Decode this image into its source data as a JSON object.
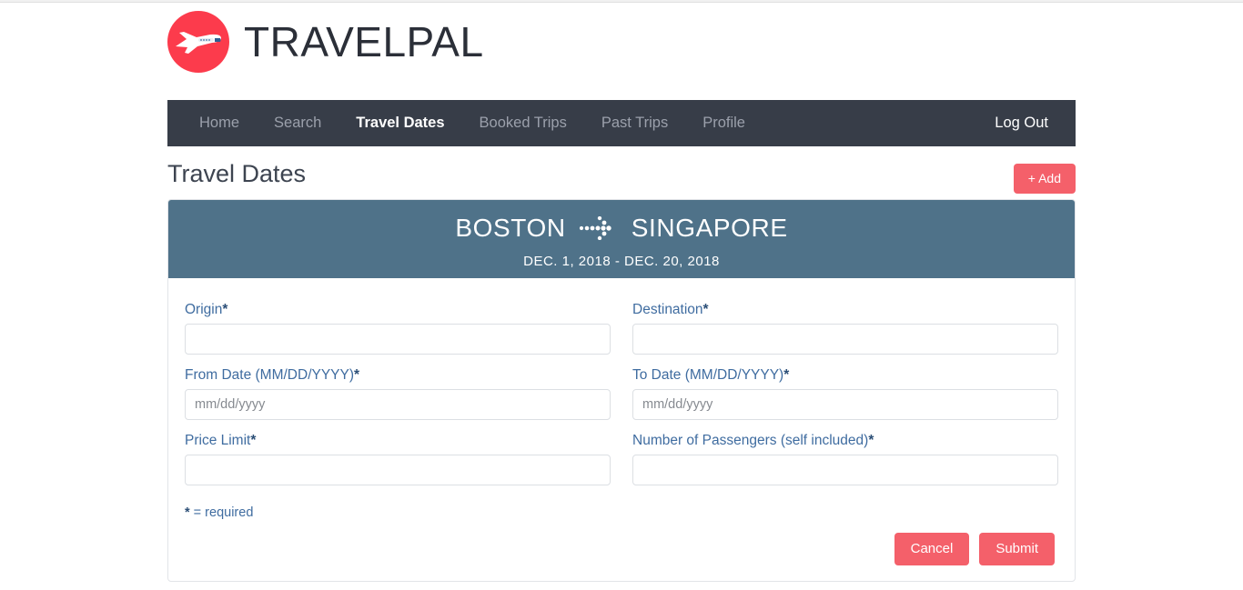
{
  "brand": {
    "name": "TRAVELPAL",
    "logo_icon": "airplane-icon",
    "logo_color": "#fc3b4c"
  },
  "nav": {
    "background_color": "#373d48",
    "items": [
      {
        "label": "Home",
        "active": false
      },
      {
        "label": "Search",
        "active": false
      },
      {
        "label": "Travel Dates",
        "active": true
      },
      {
        "label": "Booked Trips",
        "active": false
      },
      {
        "label": "Past Trips",
        "active": false
      },
      {
        "label": "Profile",
        "active": false
      }
    ],
    "logout_label": "Log Out"
  },
  "page": {
    "title": "Travel Dates",
    "add_label": "+ Add",
    "accent_color": "#f4606a"
  },
  "trip_card": {
    "header_color": "#4f7289",
    "origin_city": "BOSTON",
    "destination_city": "SINGAPORE",
    "arrow_icon": "dotted-arrow-right-icon",
    "date_range": "DEC. 1, 2018 - DEC. 20, 2018"
  },
  "form": {
    "fields": [
      {
        "label": "Origin",
        "required_mark": "*",
        "value": "",
        "placeholder": ""
      },
      {
        "label": "Destination",
        "required_mark": "*",
        "value": "",
        "placeholder": ""
      },
      {
        "label": "From Date (MM/DD/YYYY)",
        "required_mark": "*",
        "value": "",
        "placeholder": "mm/dd/yyyy"
      },
      {
        "label": "To Date (MM/DD/YYYY)",
        "required_mark": "*",
        "value": "",
        "placeholder": "mm/dd/yyyy"
      },
      {
        "label": "Price Limit",
        "required_mark": "*",
        "value": "",
        "placeholder": ""
      },
      {
        "label": "Number of Passengers (self included)",
        "required_mark": "*",
        "value": "",
        "placeholder": ""
      }
    ],
    "required_note_mark": "*",
    "required_note": " = required",
    "cancel_label": "Cancel",
    "submit_label": "Submit"
  }
}
